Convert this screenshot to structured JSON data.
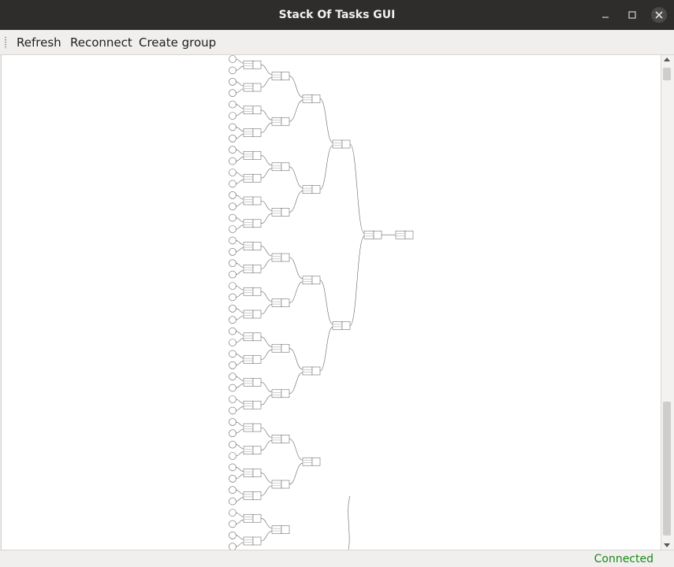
{
  "window": {
    "title": "Stack Of Tasks GUI",
    "controls": [
      "minimize-icon",
      "maximize-icon",
      "close-icon"
    ]
  },
  "toolbar": {
    "refresh_label": "Refresh",
    "reconnect_label": "Reconnect",
    "create_group_label": "Create group"
  },
  "graph": {
    "description_type": "entity-graph",
    "leaf_count": 44
  },
  "status": {
    "text": "Connected",
    "color": "#1a8a1a"
  }
}
